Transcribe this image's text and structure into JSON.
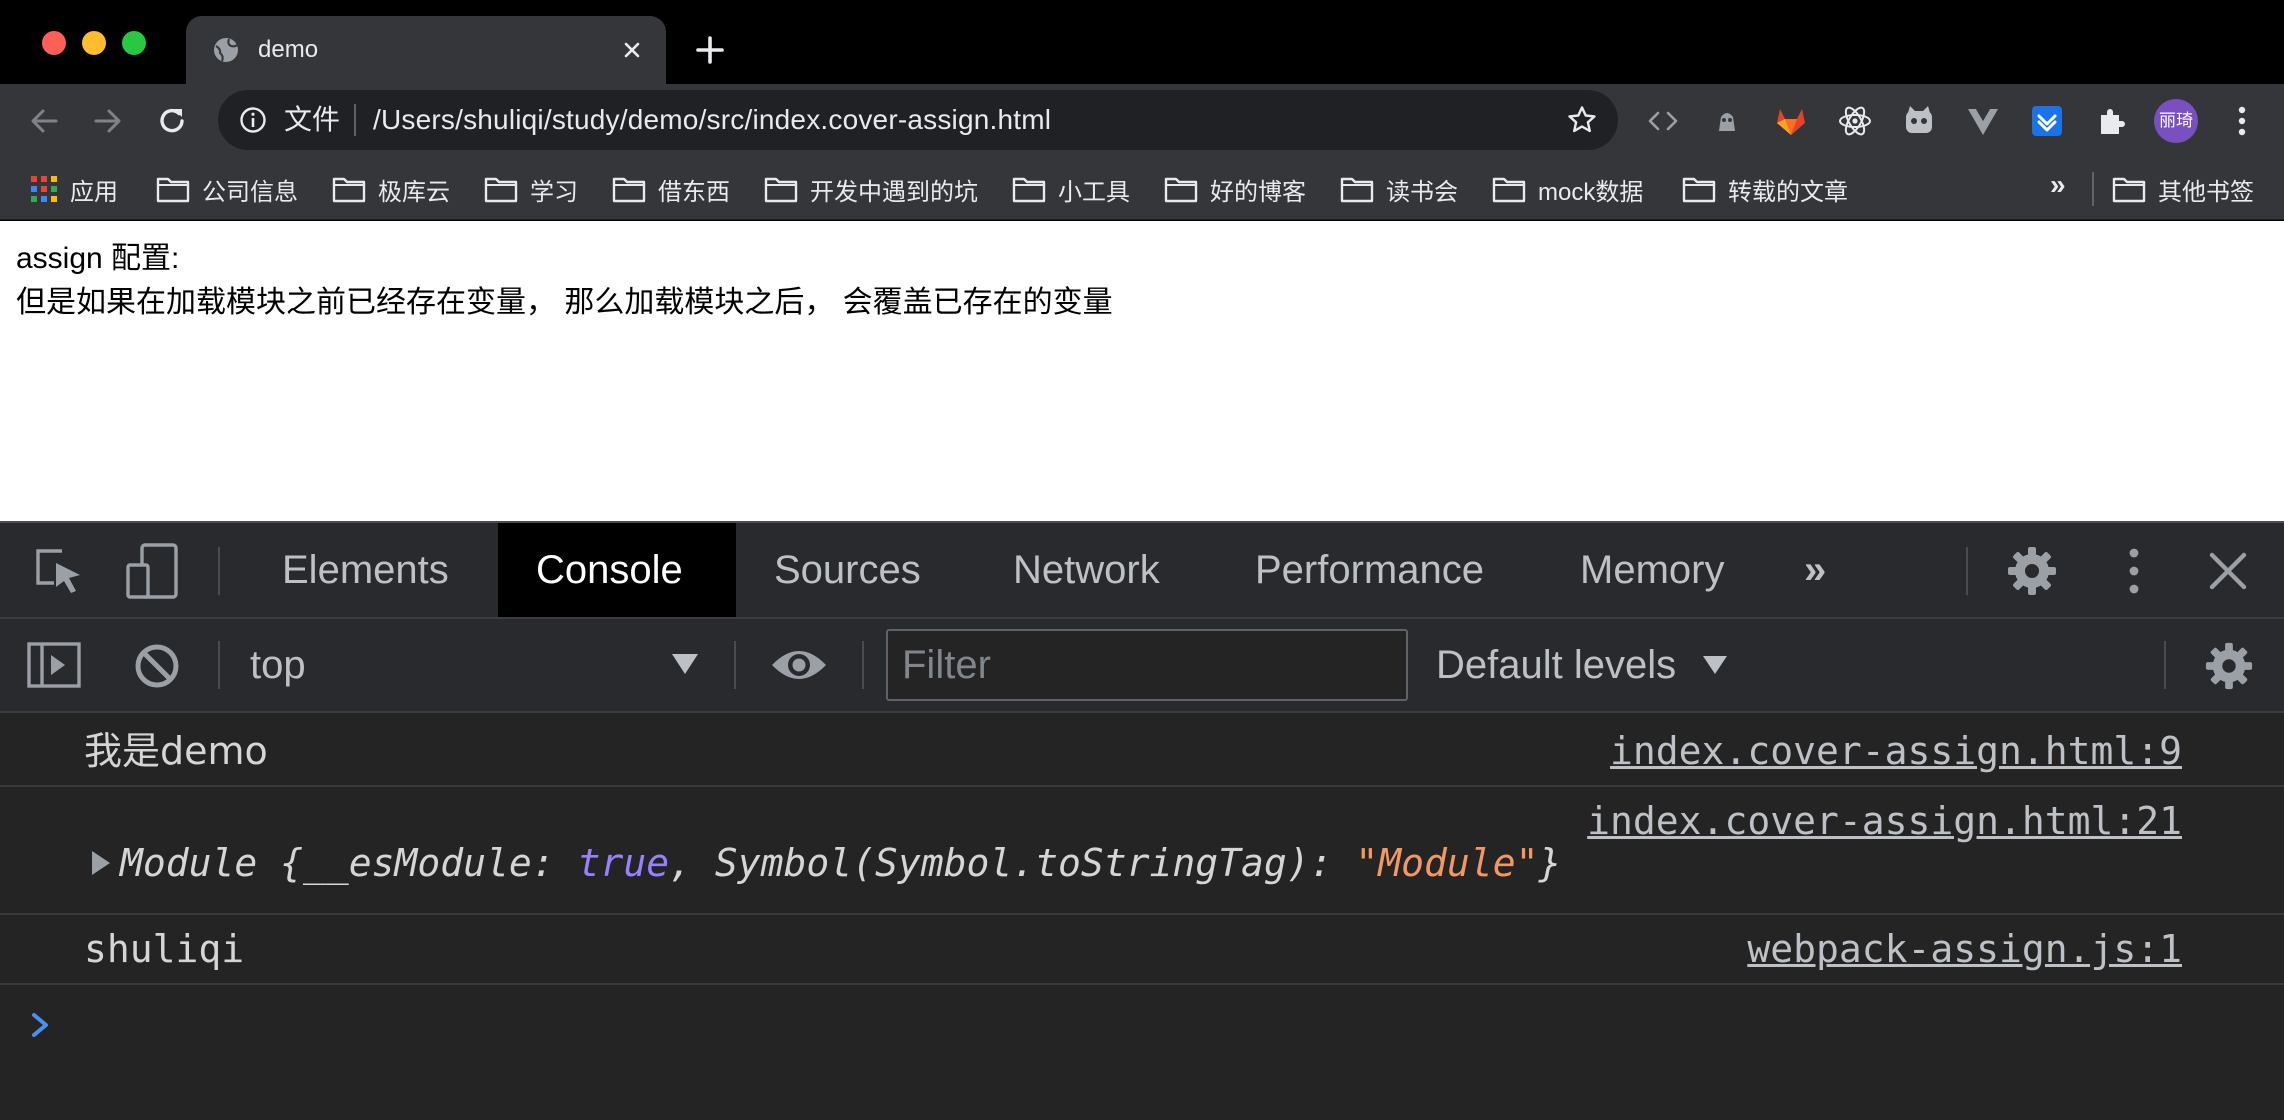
{
  "browser": {
    "tab": {
      "title": "demo"
    },
    "omnibox": {
      "scheme_label": "文件",
      "url": "/Users/shuliqi/study/demo/src/index.cover-assign.html"
    },
    "profile": {
      "avatar_text": "丽琦"
    },
    "bookmarks": {
      "items": [
        {
          "label": "应用",
          "icon": "apps-grid-icon"
        },
        {
          "label": "公司信息",
          "icon": "folder-icon"
        },
        {
          "label": "极库云",
          "icon": "folder-icon"
        },
        {
          "label": "学习",
          "icon": "folder-icon"
        },
        {
          "label": "借东西",
          "icon": "folder-icon"
        },
        {
          "label": "开发中遇到的坑",
          "icon": "folder-icon"
        },
        {
          "label": "小工具",
          "icon": "folder-icon"
        },
        {
          "label": "好的博客",
          "icon": "folder-icon"
        },
        {
          "label": "读书会",
          "icon": "folder-icon"
        },
        {
          "label": "mock数据",
          "icon": "folder-icon"
        },
        {
          "label": "转载的文章",
          "icon": "folder-icon"
        }
      ],
      "overflow_label": "»",
      "other_label": "其他书签"
    }
  },
  "page": {
    "line1": "assign 配置:",
    "line2": "但是如果在加载模块之前已经存在变量， 那么加载模块之后， 会覆盖已存在的变量"
  },
  "devtools": {
    "tabs": [
      {
        "label": "Elements",
        "active": false
      },
      {
        "label": "Console",
        "active": true
      },
      {
        "label": "Sources",
        "active": false
      },
      {
        "label": "Network",
        "active": false
      },
      {
        "label": "Performance",
        "active": false
      },
      {
        "label": "Memory",
        "active": false
      }
    ],
    "more_tabs_label": "»",
    "console_toolbar": {
      "context": "top",
      "filter_placeholder": "Filter",
      "levels_label": "Default levels"
    },
    "messages": [
      {
        "text": "我是demo",
        "source": "index.cover-assign.html:9"
      },
      {
        "source": "index.cover-assign.html:21",
        "object": {
          "prefix": "Module {__esModule: ",
          "bool": "true",
          "middle": ", Symbol(Symbol.toStringTag): ",
          "string": "\"Module\"",
          "suffix": "}"
        }
      },
      {
        "text": "shuliqi",
        "source": "webpack-assign.js:1"
      }
    ]
  },
  "colors": {
    "tab_active_bg": "#35363a",
    "devtools_bg": "#242424",
    "console_keyword": "#9980ff",
    "console_string": "#f29766",
    "prompt": "#4d8ff0"
  }
}
